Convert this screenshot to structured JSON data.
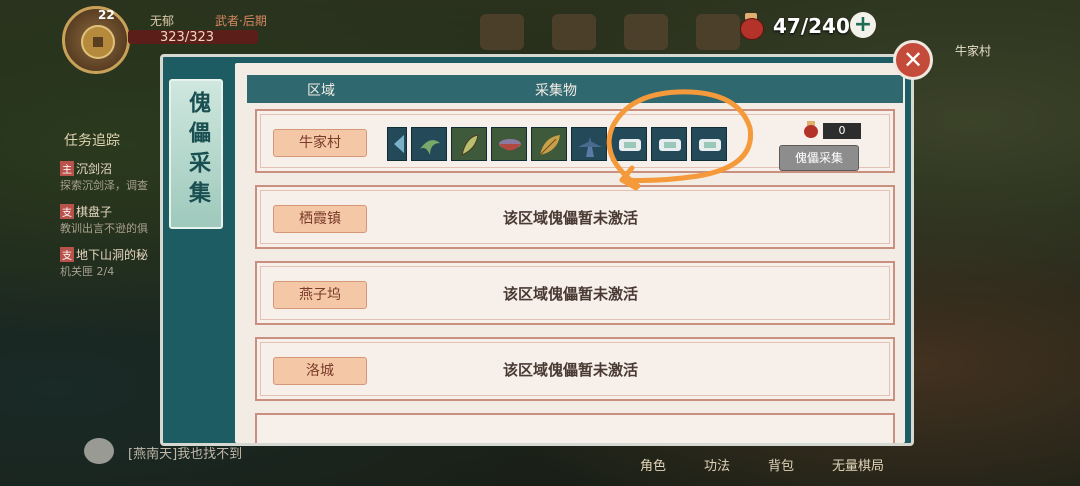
{
  "hud": {
    "level": "22",
    "player_name": "无郁",
    "rank": "武者·后期",
    "hp": "323/323",
    "resource_count": "47/240",
    "plus": "+",
    "village": "牛家村"
  },
  "quests": {
    "title": "任务追踪",
    "items": [
      {
        "tag": "主",
        "title": "沉剑沼",
        "desc": "探索沉剑泽，调查"
      },
      {
        "tag": "支",
        "title": "棋盘子",
        "desc": "教训出言不逊的俱"
      },
      {
        "tag": "支",
        "title": "地下山洞的秘",
        "desc": "机关匣 2/4"
      }
    ]
  },
  "chat": {
    "line": "[燕南天]我也找不到"
  },
  "bottom_tabs": [
    "角色",
    "功法",
    "背包",
    "无量棋局"
  ],
  "dialog": {
    "side_title": "傀儡采集",
    "headers": {
      "region": "区域",
      "gather": "采集物"
    },
    "rows": [
      {
        "region": "牛家村",
        "active": true,
        "count": "0",
        "button": "傀儡采集",
        "items": [
          "leaf-blue",
          "herb-plant",
          "green-pod",
          "bowl",
          "yellow-leaf",
          "blue-herb",
          "silver-ornament",
          "silver-ornament",
          "silver-ornament"
        ]
      },
      {
        "region": "栖霞镇",
        "active": false,
        "status": "该区域傀儡暂未激活"
      },
      {
        "region": "燕子坞",
        "active": false,
        "status": "该区域傀儡暂未激活"
      },
      {
        "region": "洛城",
        "active": false,
        "status": "该区域傀儡暂未激活"
      }
    ]
  },
  "colors": {
    "accent_teal": "#1c5c62",
    "annotation": "#f59a3b",
    "close_red": "#c44a3a"
  }
}
